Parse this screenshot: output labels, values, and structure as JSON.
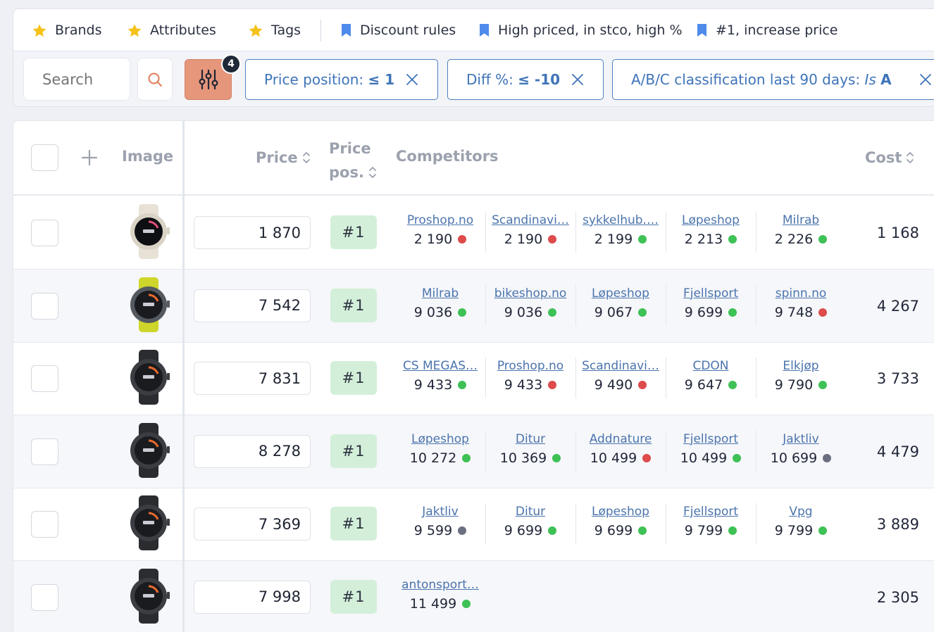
{
  "colors": {
    "accent": "#e5967b",
    "link": "#4b74ad",
    "chip_border": "#4e7fbd",
    "star": "#f4c21a",
    "bookmark": "#4f8bea",
    "pos_badge_bg": "#d3efd9",
    "status_green": "#3ec155",
    "status_red": "#dd4b4b",
    "status_gray": "#6c6f80"
  },
  "saved_filters": [
    {
      "label": "Brands",
      "icon": "star-icon"
    },
    {
      "label": "Attributes",
      "icon": "star-icon"
    },
    {
      "label": "Tags",
      "icon": "star-icon"
    },
    {
      "label": "Discount rules",
      "icon": "bookmark-icon"
    },
    {
      "label": "High priced, in stco, high %",
      "icon": "bookmark-icon"
    },
    {
      "label": "#1, increase price",
      "icon": "bookmark-icon"
    }
  ],
  "search": {
    "placeholder": "Search"
  },
  "filter_button": {
    "count": "4",
    "icon": "sliders-icon"
  },
  "active_filters": [
    {
      "name": "Price position:",
      "value": "≤ 1"
    },
    {
      "name": "Diff %:",
      "value": "≤ -10"
    },
    {
      "name": "A/B/C classification last 90 days:",
      "qualifier": "Is",
      "value": "A"
    }
  ],
  "table": {
    "headers": {
      "image": "Image",
      "price": "Price",
      "price_pos_line1": "Price",
      "price_pos_line2": "pos.",
      "competitors": "Competitors",
      "cost": "Cost"
    },
    "rows": [
      {
        "image": "light watch",
        "price": "1 870",
        "position": "#1",
        "cost": "1 168",
        "competitors": [
          {
            "name": "Proshop.no",
            "price": "2 190",
            "status": "red"
          },
          {
            "name": "Scandinavi…",
            "price": "2 190",
            "status": "red"
          },
          {
            "name": "sykkelhub.…",
            "price": "2 199",
            "status": "green"
          },
          {
            "name": "Løpeshop",
            "price": "2 213",
            "status": "green"
          },
          {
            "name": "Milrab",
            "price": "2 226",
            "status": "green"
          }
        ]
      },
      {
        "image": "yellow-strap watch",
        "price": "7 542",
        "position": "#1",
        "cost": "4 267",
        "competitors": [
          {
            "name": "Milrab",
            "price": "9 036",
            "status": "green"
          },
          {
            "name": "bikeshop.no",
            "price": "9 036",
            "status": "green"
          },
          {
            "name": "Løpeshop",
            "price": "9 067",
            "status": "green"
          },
          {
            "name": "Fjellsport",
            "price": "9 699",
            "status": "green"
          },
          {
            "name": "spinn.no",
            "price": "9 748",
            "status": "red"
          }
        ]
      },
      {
        "image": "dark watch",
        "price": "7 831",
        "position": "#1",
        "cost": "3 733",
        "competitors": [
          {
            "name": "CS MEGAS…",
            "price": "9 433",
            "status": "green"
          },
          {
            "name": "Proshop.no",
            "price": "9 433",
            "status": "red"
          },
          {
            "name": "Scandinavi…",
            "price": "9 490",
            "status": "red"
          },
          {
            "name": "CDON",
            "price": "9 647",
            "status": "green"
          },
          {
            "name": "Elkjøp",
            "price": "9 790",
            "status": "green"
          }
        ]
      },
      {
        "image": "dark watch",
        "price": "8 278",
        "position": "#1",
        "cost": "4 479",
        "competitors": [
          {
            "name": "Løpeshop",
            "price": "10 272",
            "status": "green"
          },
          {
            "name": "Ditur",
            "price": "10 369",
            "status": "green"
          },
          {
            "name": "Addnature",
            "price": "10 499",
            "status": "red"
          },
          {
            "name": "Fjellsport",
            "price": "10 499",
            "status": "green"
          },
          {
            "name": "Jaktliv",
            "price": "10 699",
            "status": "gray"
          }
        ]
      },
      {
        "image": "dark watch",
        "price": "7 369",
        "position": "#1",
        "cost": "3 889",
        "competitors": [
          {
            "name": "Jaktliv",
            "price": "9 599",
            "status": "gray"
          },
          {
            "name": "Ditur",
            "price": "9 699",
            "status": "green"
          },
          {
            "name": "Løpeshop",
            "price": "9 699",
            "status": "green"
          },
          {
            "name": "Fjellsport",
            "price": "9 799",
            "status": "green"
          },
          {
            "name": "Vpg",
            "price": "9 799",
            "status": "green"
          }
        ]
      },
      {
        "image": "dark watch",
        "price": "7 998",
        "position": "#1",
        "cost": "2 305",
        "competitors": [
          {
            "name": "antonsport…",
            "price": "11 499",
            "status": "green"
          }
        ]
      }
    ]
  }
}
